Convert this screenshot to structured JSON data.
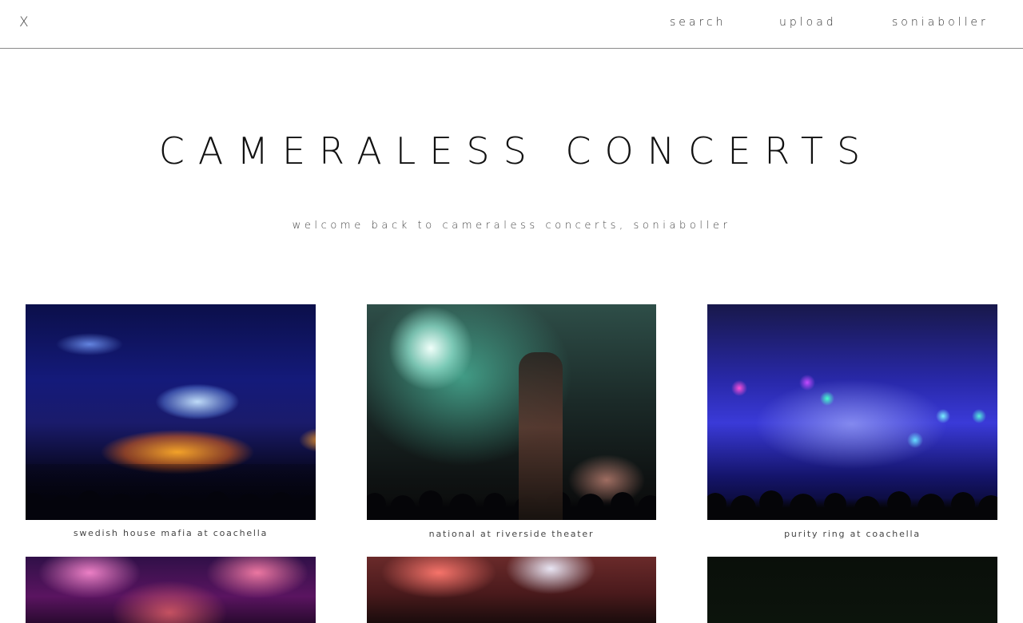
{
  "header": {
    "close_label": "X",
    "nav": {
      "search": "search",
      "upload": "upload",
      "user": "soniaboller"
    }
  },
  "hero": {
    "title": "CAMERALESS CONCERTS",
    "subtitle": "welcome back to cameraless concerts, soniaboller"
  },
  "gallery": [
    {
      "caption": "swedish house mafia at coachella"
    },
    {
      "caption": "national at riverside theater"
    },
    {
      "caption": "purity ring at coachella"
    },
    {
      "caption": ""
    },
    {
      "caption": ""
    },
    {
      "caption": ""
    }
  ]
}
